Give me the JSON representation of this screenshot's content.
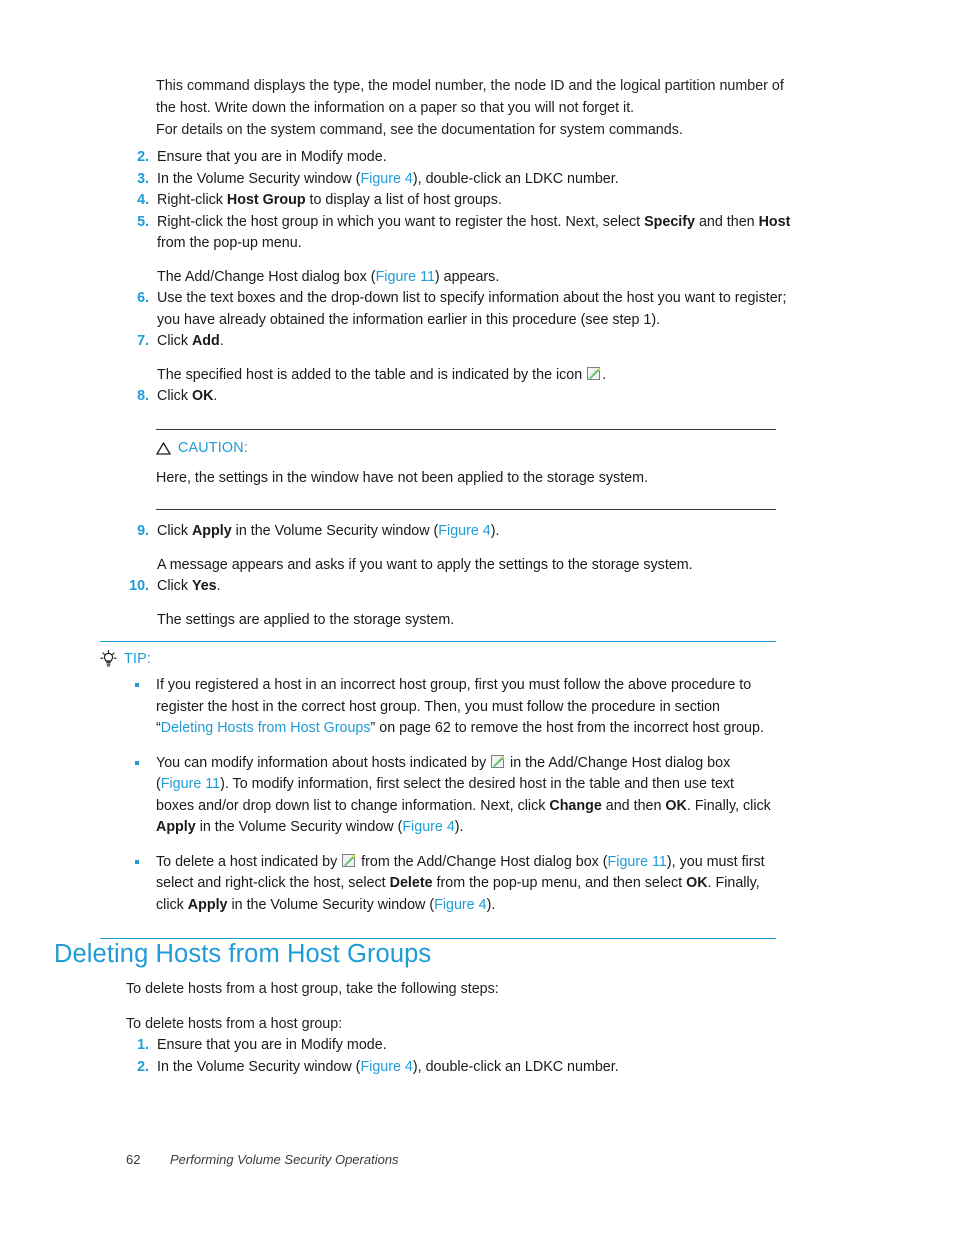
{
  "colors": {
    "accent_blue": "#1f9cd6",
    "body_text": "#231f20",
    "rule_dark": "#3b3b3b",
    "icon_green": "#22b14c",
    "icon_yellow": "#ffd400"
  },
  "intro": {
    "para1": "This command displays the type, the model number, the node ID and the logical partition number of the host. Write down the information on a paper so that you will not forget it.",
    "para2": "For details on the system command, see the documentation for system commands."
  },
  "steps_main": [
    {
      "num": "2.",
      "parts": [
        {
          "type": "plain",
          "text": "Ensure that you are in Modify mode."
        }
      ]
    },
    {
      "num": "3.",
      "parts": [
        {
          "type": "plain",
          "text": "In the Volume Security window ("
        },
        {
          "type": "xref",
          "text": "Figure 4"
        },
        {
          "type": "plain",
          "text": "), double-click an LDKC number."
        }
      ]
    },
    {
      "num": "4.",
      "parts": [
        {
          "type": "plain",
          "text": "Right-click "
        },
        {
          "type": "bold",
          "text": "Host Group"
        },
        {
          "type": "plain",
          "text": " to display a list of host groups."
        }
      ]
    },
    {
      "num": "5.",
      "parts": [
        {
          "type": "plain",
          "text": "Right-click the host group in which you want to register the host. Next, select "
        },
        {
          "type": "bold",
          "text": "Specify"
        },
        {
          "type": "plain",
          "text": " and then "
        },
        {
          "type": "bold",
          "text": "Host"
        },
        {
          "type": "plain",
          "text": " from the pop-up menu."
        }
      ],
      "sub": [
        {
          "type": "plain",
          "text": "The Add/Change Host dialog box ("
        },
        {
          "type": "xref",
          "text": "Figure 11"
        },
        {
          "type": "plain",
          "text": ") appears."
        }
      ]
    },
    {
      "num": "6.",
      "parts": [
        {
          "type": "plain",
          "text": "Use the text boxes and the drop-down list to specify information about the host you want to register; you have already obtained the information earlier in this procedure (see step 1)."
        }
      ]
    },
    {
      "num": "7.",
      "parts": [
        {
          "type": "plain",
          "text": "Click "
        },
        {
          "type": "bold",
          "text": "Add"
        },
        {
          "type": "plain",
          "text": "."
        }
      ],
      "sub": [
        {
          "type": "plain",
          "text": "The specified host is added to the table and is indicated by the icon "
        },
        {
          "type": "icon",
          "text": "host-modified-icon"
        },
        {
          "type": "plain",
          "text": "."
        }
      ]
    },
    {
      "num": "8.",
      "parts": [
        {
          "type": "plain",
          "text": "Click "
        },
        {
          "type": "bold",
          "text": "OK"
        },
        {
          "type": "plain",
          "text": "."
        }
      ]
    }
  ],
  "caution": {
    "label": "CAUTION:",
    "icon": "warning-triangle-icon",
    "body": "Here, the settings in the window have not been applied to the storage system."
  },
  "steps_after_caution": [
    {
      "num": "9.",
      "parts": [
        {
          "type": "plain",
          "text": "Click "
        },
        {
          "type": "bold",
          "text": "Apply"
        },
        {
          "type": "plain",
          "text": " in the Volume Security window ("
        },
        {
          "type": "xref",
          "text": "Figure 4"
        },
        {
          "type": "plain",
          "text": ")."
        }
      ],
      "sub": [
        {
          "type": "plain",
          "text": "A message appears and asks if you want to apply the settings to the storage system."
        }
      ]
    },
    {
      "num": "10.",
      "parts": [
        {
          "type": "plain",
          "text": "Click "
        },
        {
          "type": "bold",
          "text": "Yes"
        },
        {
          "type": "plain",
          "text": "."
        }
      ],
      "sub": [
        {
          "type": "plain",
          "text": "The settings are applied to the storage system."
        }
      ]
    }
  ],
  "tip": {
    "label": "TIP:",
    "icon": "lightbulb-icon",
    "bullets": [
      [
        {
          "type": "plain",
          "text": "If you registered a host in an incorrect host group, first you must follow the above procedure to register the host in the correct host group. Then, you must follow the procedure in section “"
        },
        {
          "type": "xref",
          "text": "Deleting Hosts from Host Groups"
        },
        {
          "type": "plain",
          "text": "” on page 62 to remove the host from the incorrect host group."
        }
      ],
      [
        {
          "type": "plain",
          "text": "You can modify information about hosts indicated by "
        },
        {
          "type": "icon",
          "text": "host-modified-icon"
        },
        {
          "type": "plain",
          "text": " in the Add/Change Host dialog box ("
        },
        {
          "type": "xref",
          "text": "Figure 11"
        },
        {
          "type": "plain",
          "text": "). To modify information, first select the desired host in the table and then use text boxes and/or drop down list to change information. Next, click "
        },
        {
          "type": "bold",
          "text": "Change"
        },
        {
          "type": "plain",
          "text": " and then "
        },
        {
          "type": "bold",
          "text": "OK"
        },
        {
          "type": "plain",
          "text": ". Finally, click "
        },
        {
          "type": "bold",
          "text": "Apply"
        },
        {
          "type": "plain",
          "text": " in the Volume Security window ("
        },
        {
          "type": "xref",
          "text": "Figure 4"
        },
        {
          "type": "plain",
          "text": ")."
        }
      ],
      [
        {
          "type": "plain",
          "text": "To delete a host indicated by "
        },
        {
          "type": "icon",
          "text": "host-modified-icon"
        },
        {
          "type": "plain",
          "text": " from the Add/Change Host dialog box ("
        },
        {
          "type": "xref",
          "text": "Figure 11"
        },
        {
          "type": "plain",
          "text": "), you must first select and right-click the host, select "
        },
        {
          "type": "bold",
          "text": "Delete"
        },
        {
          "type": "plain",
          "text": " from the pop-up menu, and then select "
        },
        {
          "type": "bold",
          "text": "OK"
        },
        {
          "type": "plain",
          "text": ". Finally, click "
        },
        {
          "type": "bold",
          "text": "Apply"
        },
        {
          "type": "plain",
          "text": " in the Volume Security window ("
        },
        {
          "type": "xref",
          "text": "Figure 4"
        },
        {
          "type": "plain",
          "text": ")."
        }
      ]
    ]
  },
  "section": {
    "heading": "Deleting Hosts from Host Groups",
    "para1": "To delete hosts from a host group, take the following steps:",
    "para2": "To delete hosts from a host group:",
    "steps": [
      {
        "num": "1.",
        "parts": [
          {
            "type": "plain",
            "text": "Ensure that you are in Modify mode."
          }
        ]
      },
      {
        "num": "2.",
        "parts": [
          {
            "type": "plain",
            "text": "In the Volume Security window ("
          },
          {
            "type": "xref",
            "text": "Figure 4"
          },
          {
            "type": "plain",
            "text": "), double-click an LDKC number."
          }
        ]
      }
    ]
  },
  "footer": {
    "page_number": "62",
    "title": "Performing Volume Security Operations"
  }
}
